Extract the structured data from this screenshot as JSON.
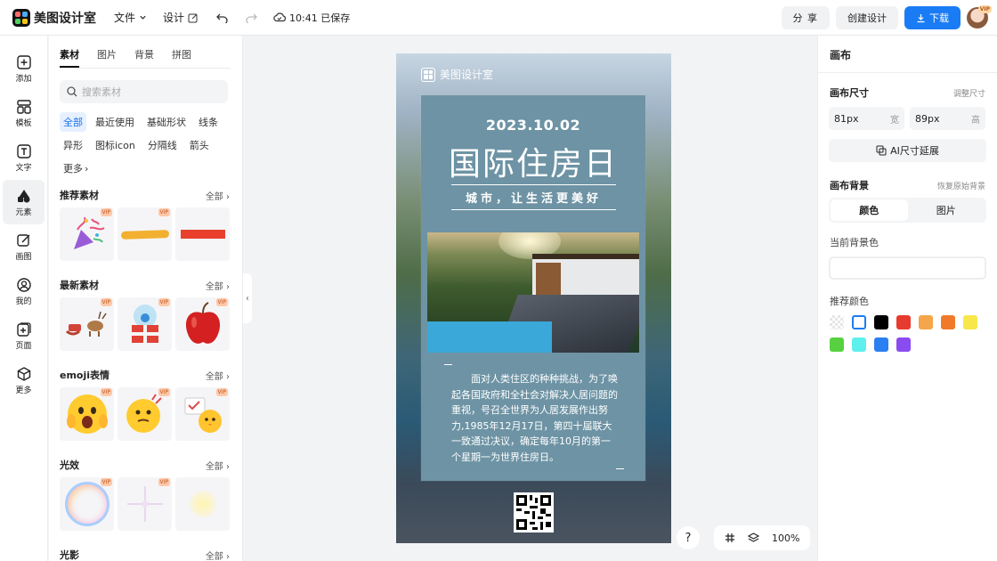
{
  "app": {
    "name": "美图设计室"
  },
  "topbar": {
    "file_label": "文件",
    "design_label": "设计",
    "saved_text": "10:41 已保存",
    "share_label": "分 享",
    "create_label": "创建设计",
    "download_label": "下载",
    "vip_badge": "VIP"
  },
  "leftnav": {
    "items": [
      {
        "label": "添加",
        "icon": "plus-square-icon"
      },
      {
        "label": "模板",
        "icon": "template-icon"
      },
      {
        "label": "文字",
        "icon": "text-icon"
      },
      {
        "label": "元素",
        "icon": "shapes-icon"
      },
      {
        "label": "画图",
        "icon": "draw-icon"
      },
      {
        "label": "我的",
        "icon": "user-icon"
      },
      {
        "label": "页面",
        "icon": "add-page-icon"
      },
      {
        "label": "更多",
        "icon": "cube-icon"
      }
    ]
  },
  "panel": {
    "tabs": [
      "素材",
      "图片",
      "背景",
      "拼图"
    ],
    "search_placeholder": "搜索素材",
    "chips": [
      "全部",
      "最近使用",
      "基础形状",
      "线条",
      "异形",
      "图标icon",
      "分隔线",
      "箭头",
      "更多"
    ],
    "sections": [
      {
        "title": "推荐素材",
        "all": "全部"
      },
      {
        "title": "最新素材",
        "all": "全部"
      },
      {
        "title": "emoji表情",
        "all": "全部"
      },
      {
        "title": "光效",
        "all": "全部"
      },
      {
        "title": "光影",
        "all": "全部"
      }
    ],
    "vip": "VIP"
  },
  "canvas": {
    "brand": "美图设计室",
    "date": "2023.10.02",
    "headline": "国际住房日",
    "subtitle": "城市，让生活更美好",
    "body": "面对人类住区的种种挑战，为了唤起各国政府和全社会对解决人居问题的重视，号召全世界为人居发展作出努力,1985年12月17日，第四十届联大一致通过决议，确定每年10月的第一个星期一为世界住房日。"
  },
  "bottom": {
    "help": "?",
    "zoom": "100%"
  },
  "right": {
    "title": "画布",
    "size_label": "画布尺寸",
    "size_adjust": "调整尺寸",
    "width_value": "81px",
    "width_unit": "宽",
    "height_value": "89px",
    "height_unit": "高",
    "ai_extend": "AI尺寸延展",
    "bg_label": "画布背景",
    "bg_reset": "恢复原始背景",
    "seg_color": "颜色",
    "seg_image": "图片",
    "current_bg": "当前背景色",
    "recommended": "推荐颜色",
    "swatches": [
      "transparent",
      "#ffffff",
      "#000000",
      "#e63b2e",
      "#f5a64a",
      "#f07a2a",
      "#f7e74a",
      "#57d13f",
      "#5ef0ec",
      "#2a7ff2",
      "#8a4cf0"
    ]
  }
}
